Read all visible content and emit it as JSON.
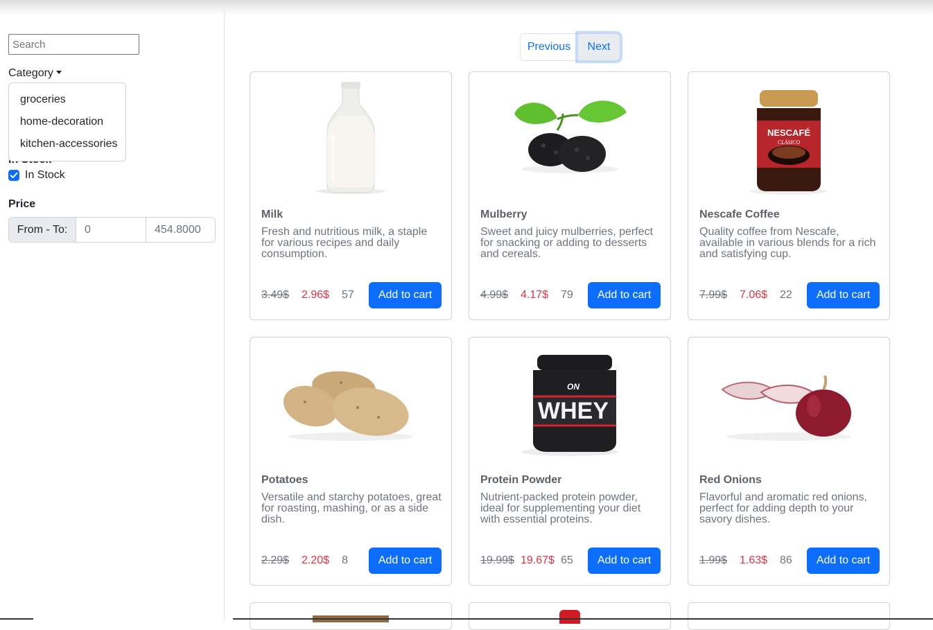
{
  "sidebar": {
    "search": {
      "placeholder": "Search",
      "value": ""
    },
    "category": {
      "label": "Category",
      "options": [
        "groceries",
        "home-decoration",
        "kitchen-accessories"
      ]
    },
    "stock": {
      "heading": "In Stock",
      "label": "In Stock",
      "checked": true
    },
    "price": {
      "heading": "Price",
      "prefix": "From - To:",
      "from": "0",
      "to": "454.8000"
    }
  },
  "pagination": {
    "previous": "Previous",
    "next": "Next"
  },
  "products": [
    {
      "title": "Milk",
      "description": "Fresh and nutritious milk, a staple for various recipes and daily consumption.",
      "old_price": "3.49$",
      "price": "2.96$",
      "stock": "57",
      "button": "Add to cart",
      "icon": "milk-bottle-image"
    },
    {
      "title": "Mulberry",
      "description": "Sweet and juicy mulberries, perfect for snacking or adding to desserts and cereals.",
      "old_price": "4.99$",
      "price": "4.17$",
      "stock": "79",
      "button": "Add to cart",
      "icon": "mulberry-image"
    },
    {
      "title": "Nescafe Coffee",
      "description": "Quality coffee from Nescafe, available in various blends for a rich and satisfying cup.",
      "old_price": "7.99$",
      "price": "7.06$",
      "stock": "22",
      "button": "Add to cart",
      "icon": "coffee-jar-image"
    },
    {
      "title": "Potatoes",
      "description": "Versatile and starchy potatoes, great for roasting, mashing, or as a side dish.",
      "old_price": "2.29$",
      "price": "2.20$",
      "stock": "8",
      "button": "Add to cart",
      "icon": "potatoes-image"
    },
    {
      "title": "Protein Powder",
      "description": "Nutrient-packed protein powder, ideal for supplementing your diet with essential proteins.",
      "old_price": "19.99$",
      "price": "19.67$",
      "stock": "65",
      "button": "Add to cart",
      "icon": "protein-tub-image"
    },
    {
      "title": "Red Onions",
      "description": "Flavorful and aromatic red onions, perfect for adding depth to your savory dishes.",
      "old_price": "1.99$",
      "price": "1.63$",
      "stock": "86",
      "button": "Add to cart",
      "icon": "red-onions-image"
    }
  ],
  "images": {
    "whey_brand": "ON",
    "whey_text": "WHEY",
    "nescafe_brand": "NESCAFÉ",
    "nescafe_sub": "CLÁSICO"
  },
  "colors": {
    "primary": "#0d6efd",
    "discount": "#dc3545",
    "muted": "#6c757d"
  }
}
